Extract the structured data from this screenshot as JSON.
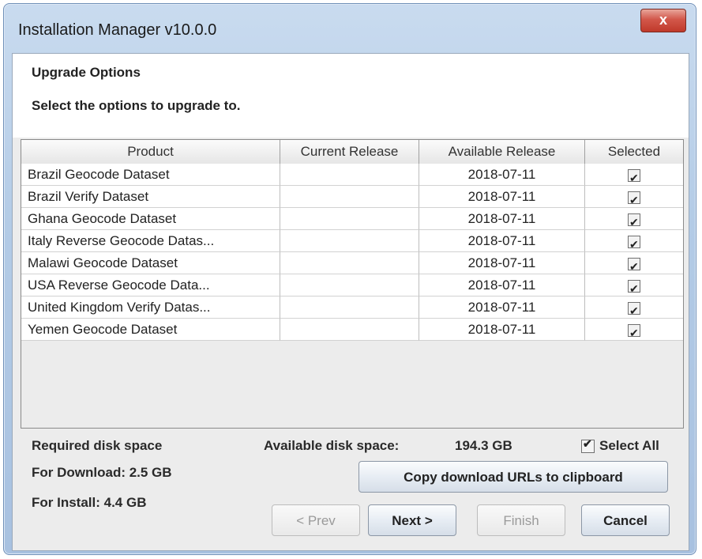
{
  "window": {
    "title": "Installation Manager v10.0.0",
    "close_label": "x"
  },
  "header": {
    "title": "Upgrade Options",
    "subtitle": "Select the options to upgrade to."
  },
  "table": {
    "columns": [
      "Product",
      "Current Release",
      "Available Release",
      "Selected"
    ],
    "rows": [
      {
        "product": "Brazil Geocode Dataset",
        "current": "",
        "available": "2018-07-11",
        "selected": true
      },
      {
        "product": "Brazil Verify Dataset",
        "current": "",
        "available": "2018-07-11",
        "selected": true
      },
      {
        "product": "Ghana Geocode Dataset",
        "current": "",
        "available": "2018-07-11",
        "selected": true
      },
      {
        "product": "Italy Reverse Geocode Datas...",
        "current": "",
        "available": "2018-07-11",
        "selected": true
      },
      {
        "product": "Malawi Geocode Dataset",
        "current": "",
        "available": "2018-07-11",
        "selected": true
      },
      {
        "product": "USA Reverse Geocode Data...",
        "current": "",
        "available": "2018-07-11",
        "selected": true
      },
      {
        "product": "United Kingdom Verify Datas...",
        "current": "",
        "available": "2018-07-11",
        "selected": true
      },
      {
        "product": "Yemen Geocode Dataset",
        "current": "",
        "available": "2018-07-11",
        "selected": true
      }
    ]
  },
  "disk": {
    "required_label": "Required disk space",
    "download_label": "For Download: 2.5 GB",
    "install_label": "For Install: 4.4 GB",
    "available_label": "Available disk space:",
    "available_value": "194.3 GB"
  },
  "select_all": {
    "label": "Select All",
    "checked": true
  },
  "buttons": {
    "copy_urls": "Copy download URLs to clipboard",
    "prev": "< Prev",
    "next": "Next >",
    "finish": "Finish",
    "cancel": "Cancel"
  }
}
